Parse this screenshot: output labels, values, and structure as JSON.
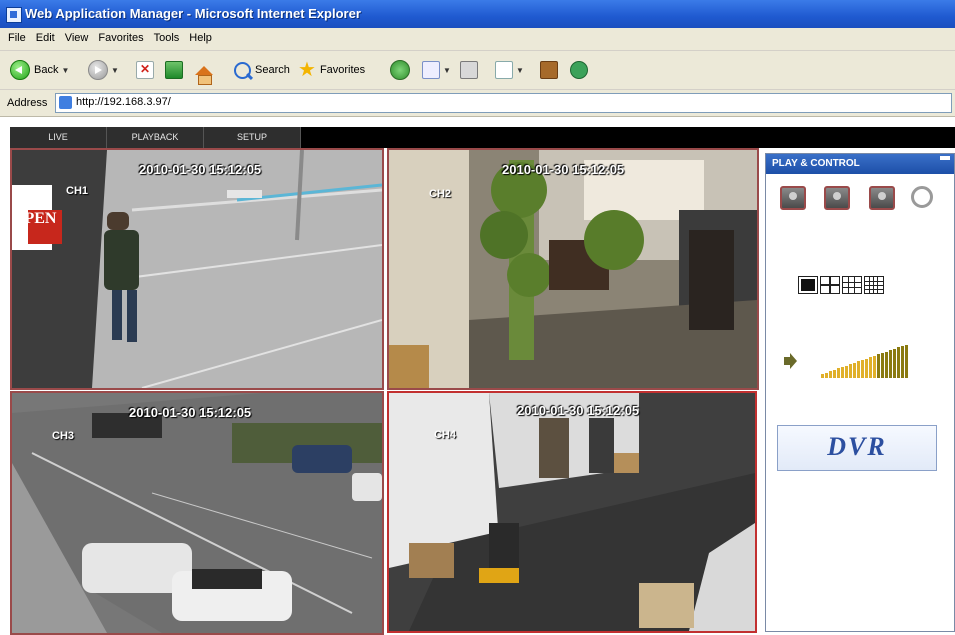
{
  "window": {
    "title": "Web Application Manager - Microsoft Internet Explorer"
  },
  "menu": [
    "File",
    "Edit",
    "View",
    "Favorites",
    "Tools",
    "Help"
  ],
  "toolbar": {
    "back_label": "Back",
    "search_label": "Search",
    "favorites_label": "Favorites"
  },
  "address": {
    "label": "Address",
    "url": "http://192.168.3.97/"
  },
  "app": {
    "tabs": [
      "LIVE",
      "PLAYBACK",
      "SETUP"
    ],
    "cameras": [
      {
        "channel": "CH1",
        "timestamp": "2010-01-30  15:12:05",
        "sign_text": "OPEN"
      },
      {
        "channel": "CH2",
        "timestamp": "2010-01-30  15:12:05"
      },
      {
        "channel": "CH3",
        "timestamp": "2010-01-30  15:12:05"
      },
      {
        "channel": "CH4",
        "timestamp": "2010-01-30  15:12:05"
      }
    ],
    "panel": {
      "title": "PLAY & CONTROL",
      "logo": "DVR",
      "control_icons": [
        "record-camera-icon",
        "snapshot-camera-icon",
        "playback-camera-icon",
        "search-key-icon"
      ],
      "layout_options": [
        "1x1",
        "2x2",
        "3x3",
        "4x4"
      ],
      "volume_level": 1.0
    }
  },
  "colors": {
    "title_bar": "#1f5ad0",
    "panel_header": "#2a5fb8",
    "selected_border": "#c23030"
  }
}
